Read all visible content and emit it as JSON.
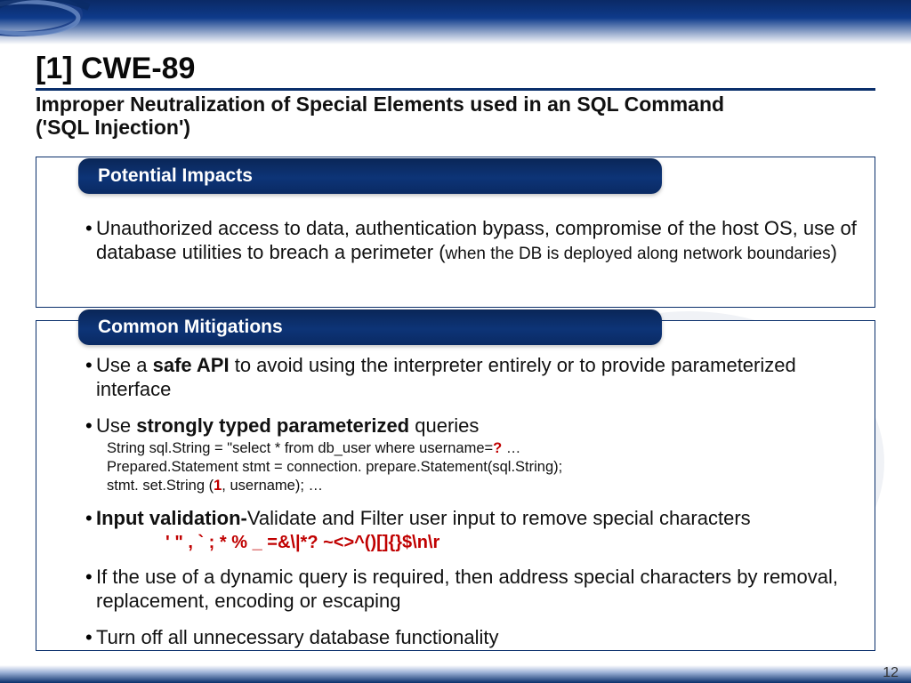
{
  "title": "[1] CWE-89",
  "subtitle": "Improper Neutralization of Special Elements used in an SQL Command ('SQL Injection')",
  "section1": {
    "heading": "Potential Impacts",
    "bullet1_main": "Unauthorized access to data, authentication bypass, compromise of the host OS, use of database utilities to breach a perimeter (",
    "bullet1_small": "when the DB is deployed along network boundaries",
    "bullet1_end": ")"
  },
  "section2": {
    "heading": "Common Mitigations",
    "b1_pre": "Use a ",
    "b1_bold": "safe API",
    "b1_post": " to avoid using the interpreter entirely or to provide parameterized interface",
    "b2_pre": "Use ",
    "b2_bold": "strongly typed parameterized",
    "b2_post": " queries",
    "code_l1_a": "String sql.String = \"select * from db_user where username=",
    "code_l1_q": "?",
    "code_l1_b": " …",
    "code_l2": "Prepared.Statement stmt = connection. prepare.Statement(sql.String);",
    "code_l3_a": "stmt. set.String (",
    "code_l3_num": "1",
    "code_l3_b": ", username); …",
    "b3_bold": "Input validation-",
    "b3_post": "Validate and Filter user input to remove special characters",
    "specials": "' \"  , ` ; * % _ =&\\|*? ~<>^()[]{}$\\n\\r",
    "b4": "If the use of a dynamic query is required, then address special characters by removal, replacement, encoding or escaping",
    "b5": "Turn off all unnecessary database functionality"
  },
  "page_number": "12"
}
